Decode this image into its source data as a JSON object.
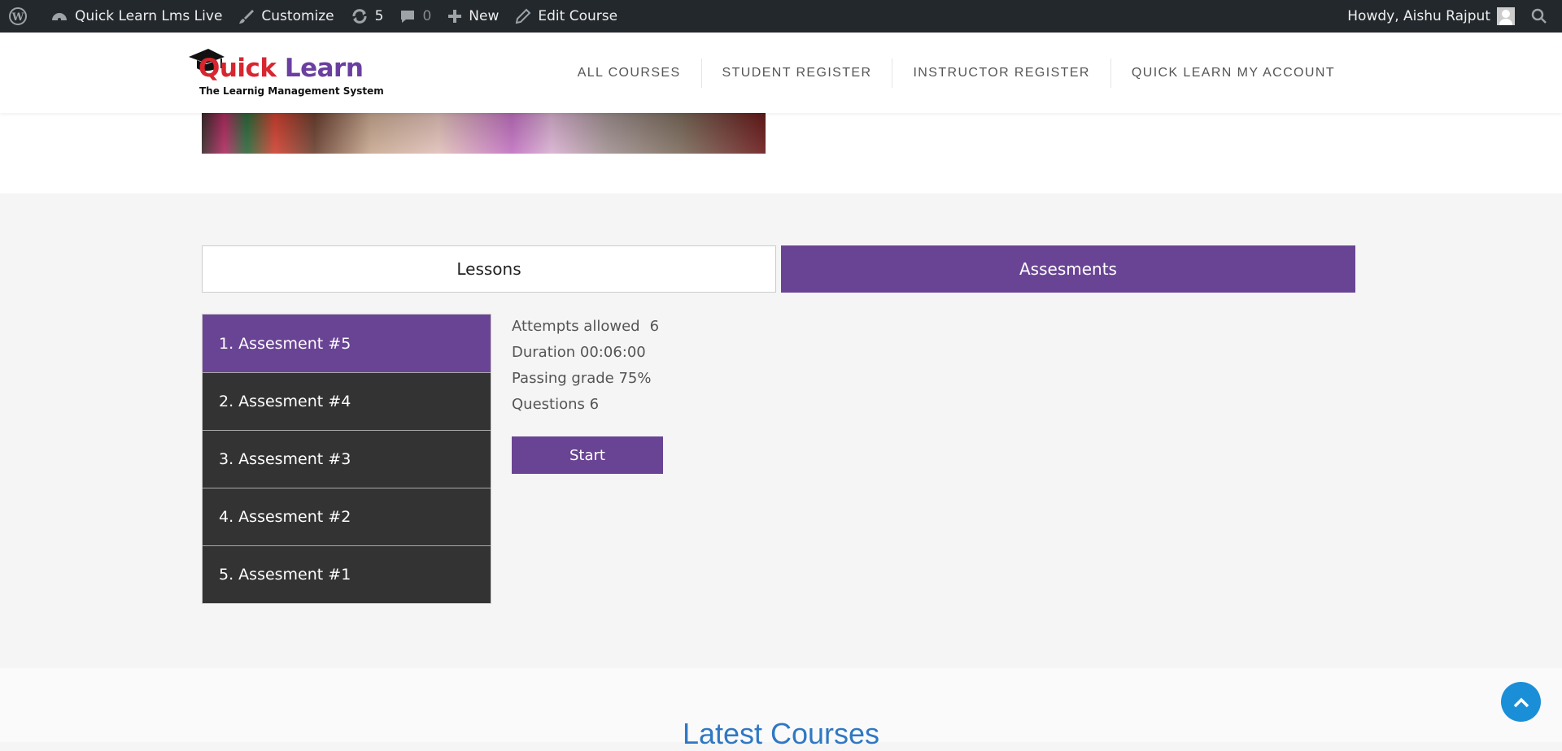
{
  "admin_bar": {
    "site_name": "Quick Learn Lms Live",
    "customize": "Customize",
    "updates_count": "5",
    "comments_count": "0",
    "new": "New",
    "edit_course": "Edit Course",
    "howdy": "Howdy, Aishu Rajput"
  },
  "logo": {
    "quick": "Quick",
    "learn": "Learn",
    "tagline": "The Learnig Management System"
  },
  "nav": [
    "ALL COURSES",
    "STUDENT REGISTER",
    "INSTRUCTOR REGISTER",
    "QUICK LEARN MY ACCOUNT"
  ],
  "tabs": {
    "lessons": "Lessons",
    "assessments": "Assesments"
  },
  "assessments": [
    "1. Assesment #5",
    "2. Assesment #4",
    "3. Assesment #3",
    "4. Assesment #2",
    "5. Assesment #1"
  ],
  "details": {
    "attempts_label": "Attempts allowed",
    "attempts_value": "6",
    "duration": "Duration 00:06:00",
    "passing": "Passing grade 75%",
    "questions": "Questions 6"
  },
  "start_label": "Start",
  "latest_title": "Latest Courses",
  "colors": {
    "accent": "#6a4494",
    "dark_item": "#333333",
    "admin_bar": "#23282d",
    "link_blue": "#2f78c4"
  }
}
